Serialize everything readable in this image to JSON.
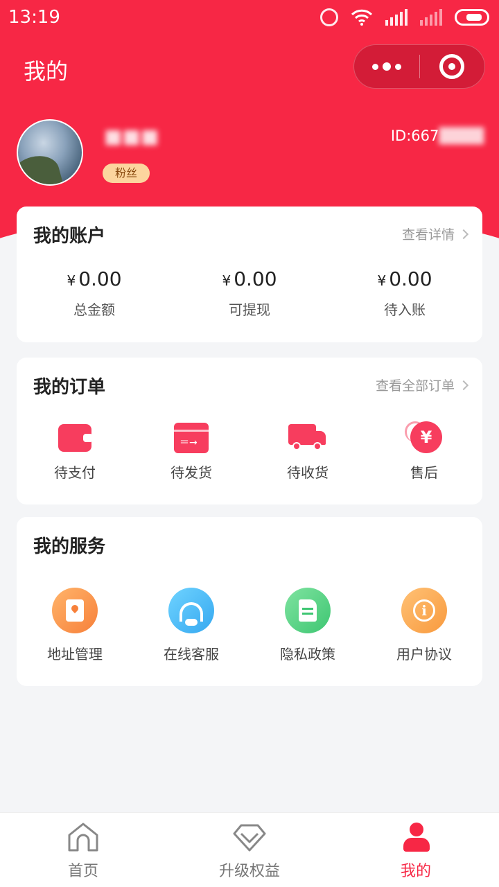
{
  "status_bar": {
    "time": "13:19"
  },
  "header": {
    "title": "我的"
  },
  "user": {
    "name": "■■■",
    "badge": "粉丝",
    "id_prefix": "ID:667",
    "id_masked": "████"
  },
  "account": {
    "title": "我的账户",
    "link": "查看详情",
    "items": [
      {
        "currency": "¥",
        "value": "0.00",
        "label": "总金额"
      },
      {
        "currency": "¥",
        "value": "0.00",
        "label": "可提现"
      },
      {
        "currency": "¥",
        "value": "0.00",
        "label": "待入账"
      }
    ]
  },
  "orders": {
    "title": "我的订单",
    "link": "查看全部订单",
    "items": [
      {
        "label": "待支付",
        "icon": "wallet-icon"
      },
      {
        "label": "待发货",
        "icon": "box-icon"
      },
      {
        "label": "待收货",
        "icon": "truck-icon"
      },
      {
        "label": "售后",
        "icon": "refund-yen-icon"
      }
    ],
    "aftersale_symbol": "¥"
  },
  "services": {
    "title": "我的服务",
    "items": [
      {
        "label": "地址管理",
        "icon": "address-book-icon"
      },
      {
        "label": "在线客服",
        "icon": "headset-icon"
      },
      {
        "label": "隐私政策",
        "icon": "document-icon"
      },
      {
        "label": "用户协议",
        "icon": "info-icon"
      }
    ],
    "info_symbol": "i"
  },
  "tabbar": {
    "items": [
      {
        "label": "首页",
        "icon": "home-icon",
        "active": false
      },
      {
        "label": "升级权益",
        "icon": "diamond-icon",
        "active": false
      },
      {
        "label": "我的",
        "icon": "person-icon",
        "active": true
      }
    ]
  },
  "colors": {
    "brand": "#f72745",
    "accent_icon": "#f73d5e"
  }
}
